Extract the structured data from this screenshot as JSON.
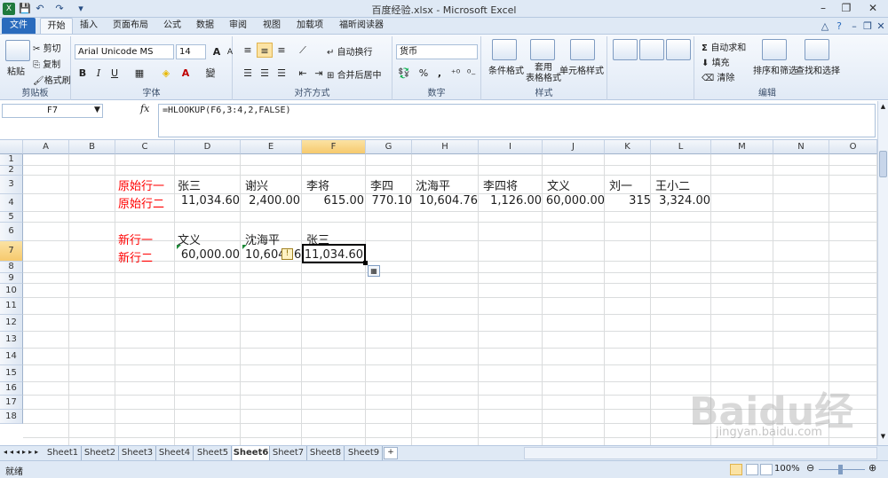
{
  "title": "百度经验.xlsx - Microsoft Excel",
  "ribbon_tabs": [
    "文件",
    "开始",
    "插入",
    "页面布局",
    "公式",
    "数据",
    "审阅",
    "视图",
    "加载项",
    "福昕阅读器"
  ],
  "clipboard": {
    "paste": "粘贴",
    "cut": "剪切",
    "copy": "复制",
    "format_painter": "格式刷",
    "group": "剪贴板"
  },
  "font": {
    "name": "Arial Unicode MS",
    "size": "14",
    "group": "字体",
    "bold": "B",
    "italic": "I",
    "underline": "U",
    "grow": "A",
    "shrink": "A"
  },
  "alignment": {
    "wrap": "自动换行",
    "merge": "合并后居中",
    "group": "对齐方式"
  },
  "number": {
    "format": "货币",
    "percent": "%",
    "comma": ",",
    "group": "数字"
  },
  "styles": {
    "conditional": "条件格式",
    "table": "套用\n表格格式",
    "cell_styles": "单元格样式",
    "group": "样式"
  },
  "cells": {
    "C3": "原始行一",
    "D3": "张三",
    "E3": "谢兴",
    "F3": "李将",
    "G3": "李四",
    "H3": "沈海平",
    "I3": "李四将",
    "J3": "文义",
    "K3": "刘一",
    "L3": "王小二",
    "C4": "原始行二",
    "D4": "11,034.60",
    "E4": "2,400.00",
    "F4": "615.00",
    "G4": "770.10",
    "H4": "10,604.76",
    "I4": "1,126.00",
    "J4": "60,000.00",
    "K4": "315",
    "L4": "3,324.00",
    "C6": "新行一",
    "D6": "文义",
    "E6": "沈海平",
    "F6": "张三",
    "C7": "新行二",
    "D7": "60,000.00",
    "E7": "10,604",
    "E7b": "6",
    "F7": "11,034.60"
  },
  "editing": {
    "autosum": "自动求和",
    "fill": "填充",
    "clear": "清除",
    "sort": "排序和筛选",
    "find": "查找和选择",
    "group": "编辑"
  },
  "name_box": "F7",
  "fx": "fx",
  "formula": "=HLOOKUP(F6,3:4,2,FALSE)",
  "columns": [
    "A",
    "B",
    "C",
    "D",
    "E",
    "F",
    "G",
    "H",
    "I",
    "J",
    "K",
    "L",
    "M",
    "N",
    "O"
  ],
  "rows": [
    "1",
    "2",
    "3",
    "4",
    "5",
    "6",
    "7",
    "8",
    "9",
    "10",
    "11",
    "12",
    "13",
    "14",
    "15",
    "16",
    "17",
    "18"
  ],
  "sheets": [
    "Sheet1",
    "Sheet2",
    "Sheet3",
    "Sheet4",
    "Sheet5",
    "Sheet6",
    "Sheet7",
    "Sheet8",
    "Sheet9"
  ],
  "active_sheet": "Sheet6",
  "status": {
    "mode": "就绪",
    "zoom": "100%"
  },
  "watermark": {
    "brand": "Baidu经验",
    "url": "jingyan.baidu.com"
  },
  "colors": {
    "accent": "#2a6bbd",
    "red_text": "#ff0000",
    "selected_header": "#f6c96d"
  }
}
